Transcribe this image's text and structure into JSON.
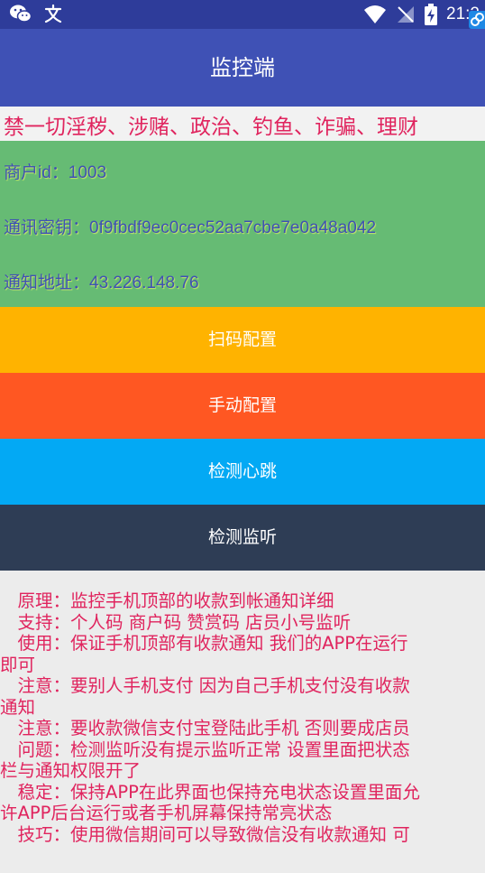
{
  "status_bar": {
    "time": "21:2",
    "left_icons": [
      "wechat-icon",
      "text-input-icon"
    ],
    "right_icons": [
      "wifi-icon",
      "no-signal-icon",
      "battery-charging-icon"
    ]
  },
  "app_bar": {
    "title": "监控端"
  },
  "banner": {
    "text": "禁一切淫秽、涉赌、政治、钓鱼、诈骗、理财"
  },
  "info": {
    "merchant_id": "商户id：1003",
    "secret_key": "通讯密钥：0f9fbdf9ec0cec52aa7cbe7e0a48a042",
    "notify_address": "通知地址：43.226.148.76"
  },
  "buttons": {
    "scan_config": "扫码配置",
    "manual_config": "手动配置",
    "check_heartbeat": "检测心跳",
    "check_listener": "检测监听"
  },
  "notes": [
    "　原理：监控手机顶部的收款到帐通知详细",
    "　支持：个人码 商户码 赞赏码 店员小号监听",
    "　使用：保证手机顶部有收款通知 我们的APP在运行",
    "即可",
    "　注意：要别人手机支付 因为自己手机支付没有收款",
    "通知",
    "　注意：要收款微信支付宝登陆此手机 否则要成店员",
    "　问题：检测监听没有提示监听正常 设置里面把状态",
    "栏与通知权限开了",
    "　稳定：保持APP在此界面也保持充电状态设置里面允",
    "许APP后台运行或者手机屏幕保持常亮状态",
    "　技巧：使用微信期间可以导致微信没有收款通知 可"
  ],
  "colors": {
    "status_bar": "#2E3C9A",
    "app_bar": "#3F51B5",
    "info_background": "#66BB74",
    "scan_button": "#FFB300",
    "manual_button": "#FF5722",
    "heartbeat_button": "#03A9F4",
    "listener_button": "#2E3D55",
    "accent_text": "#E0245E"
  }
}
